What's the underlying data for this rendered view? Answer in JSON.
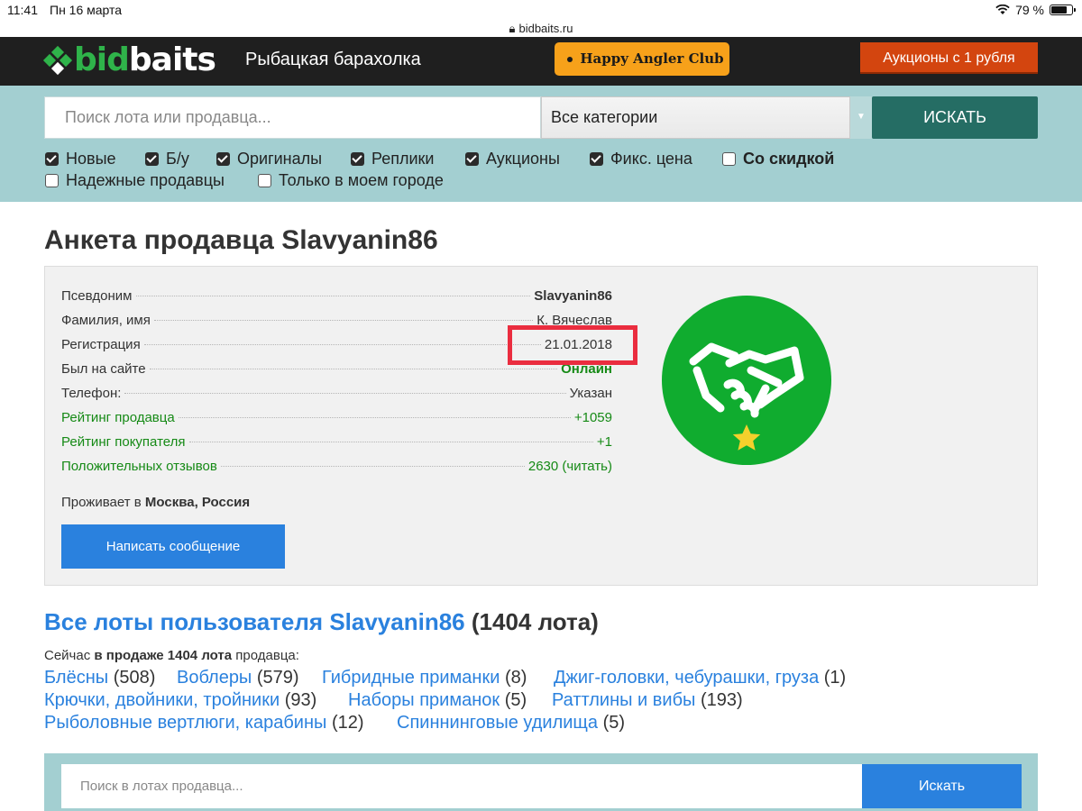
{
  "status_bar": {
    "time": "11:41",
    "date": "Пн 16 марта",
    "battery": "79 %",
    "battery_level": 0.79,
    "url": "bidbaits.ru"
  },
  "header": {
    "logo_bid": "bid",
    "logo_baits": "baits",
    "tagline": "Рыбацкая барахолка",
    "club_label": "Happy Angler Club",
    "auctions_label": "Аукционы с 1 рубля"
  },
  "search": {
    "placeholder": "Поиск лота или продавца...",
    "category": "Все категории",
    "button": "ИСКАТЬ",
    "filters": [
      {
        "label": "Новые",
        "checked": true
      },
      {
        "label": "Б/у",
        "checked": true
      },
      {
        "label": "Оригиналы",
        "checked": true
      },
      {
        "label": "Реплики",
        "checked": true
      },
      {
        "label": "Аукционы",
        "checked": true
      },
      {
        "label": "Фикс. цена",
        "checked": true
      },
      {
        "label": "Со скидкой",
        "checked": false
      },
      {
        "label": "Надежные продавцы",
        "checked": false
      },
      {
        "label": "Только в моем городе",
        "checked": false
      }
    ]
  },
  "profile": {
    "title_prefix": "Анкета продавца",
    "username": "Slavyanin86",
    "rows": [
      {
        "label": "Псевдоним",
        "value": "Slavyanin86"
      },
      {
        "label": "Фамилия, имя",
        "value": "К. Вячеслав"
      },
      {
        "label": "Регистрация",
        "value": "21.01.2018"
      },
      {
        "label": "Был на сайте",
        "value": "Онлайн"
      },
      {
        "label": "Телефон:",
        "value": "Указан"
      },
      {
        "label": "Рейтинг продавца",
        "value": "+1059"
      },
      {
        "label": "Рейтинг покупателя",
        "value": "+1"
      },
      {
        "label": "Положительных отзывов",
        "value": "2630 (читать)"
      }
    ],
    "lives_prefix": "Проживает в",
    "location": "Москва, Россия",
    "message_button": "Написать сообщение"
  },
  "lots": {
    "title_prefix": "Все лоты пользователя",
    "username": "Slavyanin86",
    "count_text": "(1404 лота)",
    "sale_prefix": "Сейчас",
    "sale_bold": "в продаже 1404 лота",
    "sale_suffix": "продавца:",
    "categories": [
      {
        "name": "Блёсны",
        "count": "(508)"
      },
      {
        "name": "Воблеры",
        "count": "(579)"
      },
      {
        "name": "Гибридные приманки",
        "count": "(8)"
      },
      {
        "name": "Джиг-головки, чебурашки, груза",
        "count": "(1)"
      },
      {
        "name": "Крючки, двойники, тройники",
        "count": "(93)"
      },
      {
        "name": "Наборы приманок",
        "count": "(5)"
      },
      {
        "name": "Раттлины и вибы",
        "count": "(193)"
      },
      {
        "name": "Рыболовные вертлюги, карабины",
        "count": "(12)"
      },
      {
        "name": "Спиннинговые удилища",
        "count": "(5)"
      }
    ]
  },
  "seller_search": {
    "placeholder": "Поиск в лотах продавца...",
    "button": "Искать"
  },
  "colors": {
    "accent_blue": "#2a81de",
    "brand_green": "#2fb34a",
    "highlight_red": "#ea2d3f",
    "band_teal": "#a3cfd1"
  }
}
